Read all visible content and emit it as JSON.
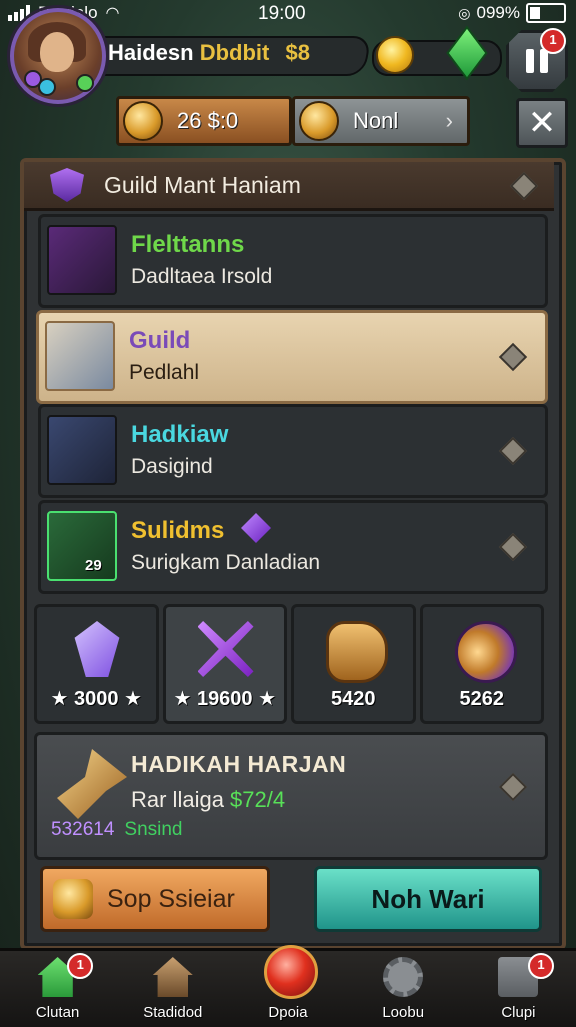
{
  "status_bar": {
    "carrier": "Dardalo",
    "time": "19:00",
    "battery": "099%"
  },
  "player": {
    "name": "Haidesn",
    "guild": "Dbdbit",
    "amount": "$8"
  },
  "currency": {
    "gold_value": "26 $:0",
    "secondary_label": "Nonl",
    "chevron": "›"
  },
  "hud": {
    "pause_badge": "1",
    "close_symbol": "✕"
  },
  "panel": {
    "title": "Guild Mant Haniam",
    "rows": [
      {
        "title": "Flelttanns",
        "subtitle": "Dadltaea Irsold",
        "title_color": "#6fd84a",
        "icon": "dagger-icon"
      },
      {
        "title": "Guild",
        "subtitle": "Pedlahl",
        "title_color": "#7a4ab8",
        "icon": "axe-icon"
      },
      {
        "title": "Hadkiaw",
        "subtitle": "Dasigind",
        "title_color": "#4ad8e0",
        "icon": "sword-icon"
      },
      {
        "title": "Sulidms",
        "subtitle": "Surigkam Danladian",
        "title_color": "#f0c030",
        "icon": "spear-icon",
        "badge": "29"
      }
    ],
    "items": [
      {
        "value": "★ 3000 ★",
        "icon": "crystal-icon"
      },
      {
        "value": "★ 19600 ★",
        "icon": "crossed-blades-icon"
      },
      {
        "value": "5420",
        "icon": "barrel-icon"
      },
      {
        "value": "5262",
        "icon": "cannon-icon"
      }
    ],
    "featured": {
      "title": "HADIKAH HARJAN",
      "sub_prefix": "Rar llaiga ",
      "sub_value": "$72/4",
      "foot_number": "532614",
      "foot_label": "Snsind"
    }
  },
  "actions": {
    "left_label": "Sop Ssieiar",
    "right_label": "Noh Wari"
  },
  "bottom_nav": [
    {
      "label": "Clutan",
      "badge": "1",
      "icon": "home-icon"
    },
    {
      "label": "Stadidod",
      "badge": "",
      "icon": "guild-house-icon"
    },
    {
      "label": "Dpoia",
      "badge": "",
      "icon": "orb-icon"
    },
    {
      "label": "Loobu",
      "badge": "",
      "icon": "gear-icon"
    },
    {
      "label": "Clupi",
      "badge": "1",
      "icon": "grid-icon"
    }
  ],
  "colors": {
    "panel_border": "#5a4430",
    "gold": "#e8c040",
    "teal": "#20948a"
  }
}
